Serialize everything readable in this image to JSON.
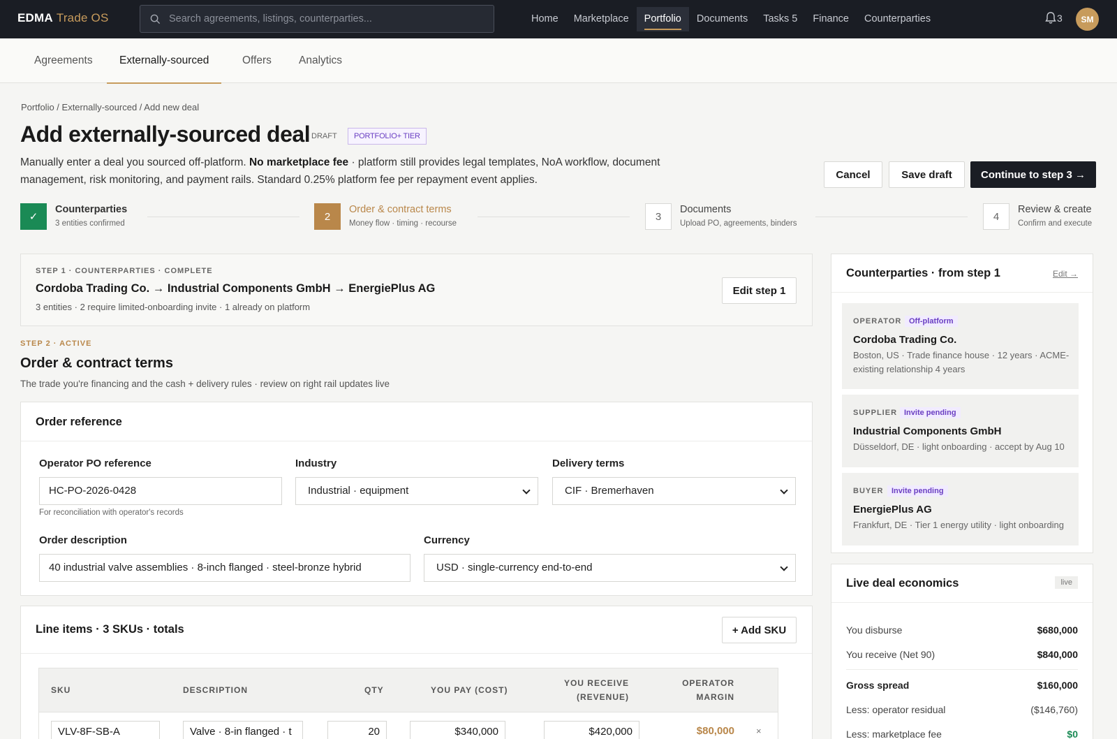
{
  "app": {
    "brand": "EDMA",
    "brand_sub": "Trade OS"
  },
  "search": {
    "placeholder": "Search agreements, listings, counterparties..."
  },
  "nav": [
    {
      "label": "Home"
    },
    {
      "label": "Marketplace"
    },
    {
      "label": "Portfolio",
      "active": true
    },
    {
      "label": "Documents"
    },
    {
      "label": "Tasks 5"
    },
    {
      "label": "Finance"
    },
    {
      "label": "Counterparties"
    }
  ],
  "notifications": {
    "count": "3"
  },
  "user": {
    "initials": "SM"
  },
  "subtabs": [
    "Agreements",
    "Externally-sourced",
    "Offers",
    "Analytics"
  ],
  "breadcrumb": "Portfolio / Externally-sourced / Add new deal",
  "page": {
    "title": "Add externally-sourced deal",
    "status": "DRAFT",
    "tier": "PORTFOLIO+ TIER",
    "desc_pre": "Manually enter a deal you sourced off-platform. ",
    "desc_bold": "No marketplace fee",
    "desc_post": " · platform still provides legal templates, NoA workflow, document management, risk monitoring, and payment rails. Standard 0.25% platform fee per repayment event applies."
  },
  "actions": {
    "cancel": "Cancel",
    "save": "Save draft",
    "continue": "Continue to step 3 →"
  },
  "steps": [
    {
      "num": "✓",
      "title": "Counterparties",
      "sub": "3 entities confirmed"
    },
    {
      "num": "2",
      "title": "Order & contract terms",
      "sub": "Money flow · timing · recourse"
    },
    {
      "num": "3",
      "title": "Documents",
      "sub": "Upload PO, agreements, binders"
    },
    {
      "num": "4",
      "title": "Review & create",
      "sub": "Confirm and execute"
    }
  ],
  "step1": {
    "eyebrow": "STEP 1 · COUNTERPARTIES · COMPLETE",
    "route": "Cordoba Trading Co. → Industrial Components GmbH → EnergiePlus AG",
    "meta": "3 entities · 2 require limited-onboarding invite · 1 already on platform",
    "edit": "Edit step 1"
  },
  "step2": {
    "eyebrow": "STEP 2 · ACTIVE",
    "title": "Order & contract terms",
    "sub": "The trade you're financing and the cash + delivery rules · review on right rail updates live"
  },
  "order": {
    "section_title": "Order reference",
    "po_label": "Operator PO reference",
    "po_value": "HC-PO-2026-0428",
    "po_hint": "For reconciliation with operator's records",
    "industry_label": "Industry",
    "industry_value": "Industrial · equipment",
    "delivery_label": "Delivery terms",
    "delivery_value": "CIF · Bremerhaven",
    "desc_label": "Order description",
    "desc_value": "40 industrial valve assemblies · 8-inch flanged · steel-bronze hybrid",
    "currency_label": "Currency",
    "currency_value": "USD · single-currency end-to-end"
  },
  "lineitems": {
    "title": "Line items · 3 SKUs · totals",
    "add": "+ Add SKU",
    "headers": [
      "SKU",
      "DESCRIPTION",
      "QTY",
      "YOU PAY (COST)",
      "YOU RECEIVE",
      "(REVENUE)",
      "OPERATOR",
      "MARGIN"
    ],
    "rows": [
      {
        "sku": "VLV-8F-SB-A",
        "description": "Valve · 8-in flanged · t",
        "qty": "20",
        "cost": "$340,000",
        "revenue": "$420,000",
        "margin": "$80,000",
        "remove": "×"
      }
    ]
  },
  "rail": {
    "title": "Counterparties · from step 1",
    "edit": "Edit →",
    "parties": [
      {
        "role": "OPERATOR",
        "tag": "Off-platform",
        "name": "Cordoba Trading Co.",
        "meta": "Boston, US · Trade finance house · 12 years · ACME-existing relationship 4 years"
      },
      {
        "role": "SUPPLIER",
        "tag": "Invite pending",
        "name": "Industrial Components GmbH",
        "meta": "Düsseldorf, DE · light onboarding · accept by Aug 10"
      },
      {
        "role": "BUYER",
        "tag": "Invite pending",
        "name": "EnergiePlus AG",
        "meta": "Frankfurt, DE · Tier 1 energy utility · light onboarding"
      }
    ]
  },
  "economics": {
    "title": "Live deal economics",
    "badge": "live",
    "rows": [
      {
        "label": "You disburse",
        "value": "$680,000"
      },
      {
        "label": "You receive (Net 90)",
        "value": "$840,000"
      },
      {
        "label": "Gross spread",
        "value": "$160,000"
      },
      {
        "label": "Less: operator residual",
        "value": "($146,760)"
      },
      {
        "label": "Less: marketplace fee",
        "value": "$0"
      }
    ]
  },
  "colors": {
    "accent": "#c79b5c",
    "step_active": "#b9874a",
    "success": "#1a8a55",
    "tag_purple": "#6a3fc2",
    "topbar": "#1a1d24"
  }
}
